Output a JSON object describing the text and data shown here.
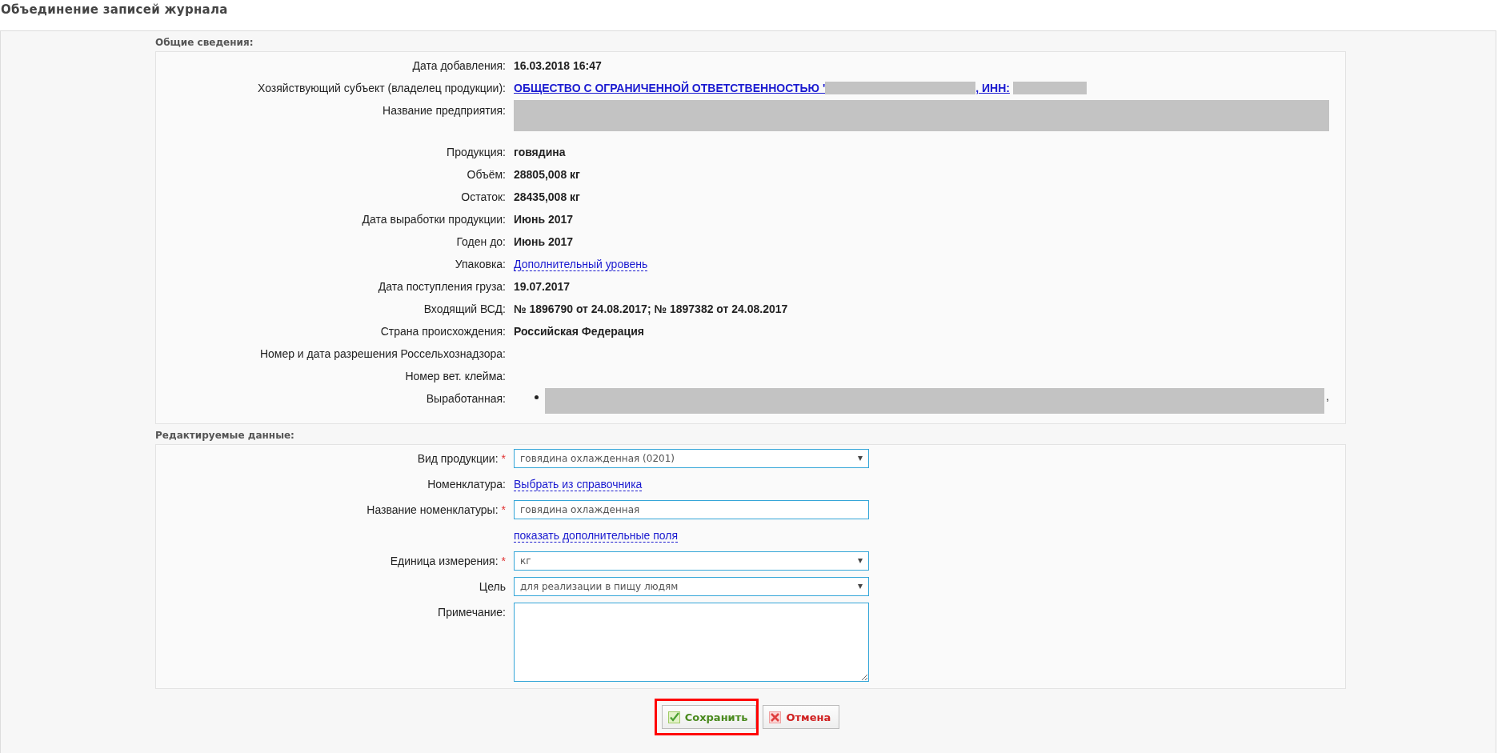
{
  "page": {
    "title": "Объединение записей журнала"
  },
  "info": {
    "heading": "Общие сведения:",
    "rows": [
      {
        "kind": "value",
        "label": "Дата добавления:",
        "value": "16.03.2018 16:47"
      },
      {
        "kind": "owner",
        "label": "Хозяйствующий субъект (владелец продукции):",
        "value": "ОБЩЕСТВО С ОГРАНИЧЕННОЙ ОТВЕТСТВЕННОСТЬЮ '",
        "suffix": ", ИНН:"
      },
      {
        "kind": "redacted",
        "label": "Название предприятия:"
      },
      {
        "kind": "value",
        "label": "Продукция:",
        "value": "говядина"
      },
      {
        "kind": "value",
        "label": "Объём:",
        "value": "28805,008 кг"
      },
      {
        "kind": "value",
        "label": "Остаток:",
        "value": "28435,008 кг"
      },
      {
        "kind": "value",
        "label": "Дата выработки продукции:",
        "value": "Июнь 2017"
      },
      {
        "kind": "value",
        "label": "Годен до:",
        "value": "Июнь 2017"
      },
      {
        "kind": "link",
        "label": "Упаковка:",
        "value": "Дополнительный уровень"
      },
      {
        "kind": "value",
        "label": "Дата поступления груза:",
        "value": "19.07.2017"
      },
      {
        "kind": "value",
        "label": "Входящий ВСД:",
        "value": "№ 1896790 от 24.08.2017; № 1897382 от 24.08.2017"
      },
      {
        "kind": "value",
        "label": "Страна происхождения:",
        "value": "Российская Федерация"
      },
      {
        "kind": "empty",
        "label": "Номер и дата разрешения Россельхознадзора:"
      },
      {
        "kind": "empty",
        "label": "Номер вет. клейма:"
      },
      {
        "kind": "list",
        "label": "Выработанная:",
        "suffix": ","
      }
    ]
  },
  "edit": {
    "heading": "Редактируемые данные:",
    "rows": [
      {
        "kind": "select",
        "label": "Вид продукции:",
        "required_mark": "*",
        "value": "говядина охлажденная (0201)"
      },
      {
        "kind": "link",
        "label": "Номенклатура:",
        "value": "Выбрать из справочника"
      },
      {
        "kind": "input",
        "label": "Название номенклатуры:",
        "required_mark": "*",
        "value": "говядина охлажденная"
      },
      {
        "kind": "link",
        "value": "показать дополнительные поля"
      },
      {
        "kind": "select",
        "label": "Единица измерения:",
        "required_mark": "*",
        "value": "кг"
      },
      {
        "kind": "select",
        "label": "Цель",
        "value": "для реализации в пищу людям"
      },
      {
        "kind": "textarea",
        "label": "Примечание:"
      }
    ]
  },
  "buttons": [
    {
      "kind": "save",
      "label": "Сохранить",
      "highlighted": true
    },
    {
      "kind": "cancel",
      "label": "Отмена",
      "highlighted": false
    }
  ]
}
